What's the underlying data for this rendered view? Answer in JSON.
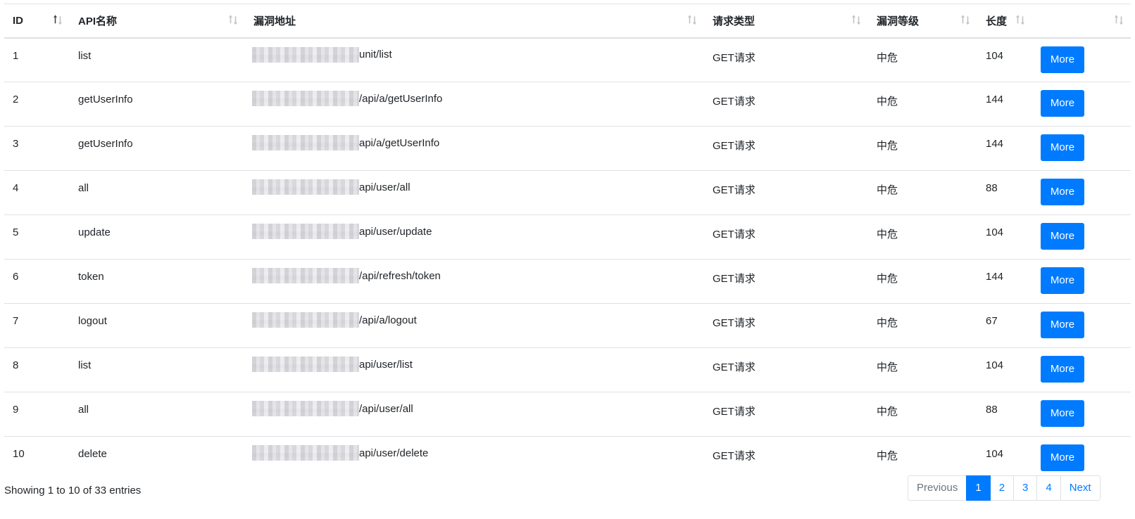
{
  "table": {
    "columns": [
      {
        "label": "ID",
        "sort": "asc"
      },
      {
        "label": "API名称",
        "sort": "none"
      },
      {
        "label": "漏洞地址",
        "sort": "none"
      },
      {
        "label": "请求类型",
        "sort": "none"
      },
      {
        "label": "漏洞等级",
        "sort": "none"
      },
      {
        "label": "长度",
        "sort": "none"
      },
      {
        "label": "",
        "sort": "none"
      }
    ],
    "rows": [
      {
        "id": "1",
        "name": "list",
        "address": "unit/list",
        "method": "GET请求",
        "level": "中危",
        "length": "104",
        "action": "More"
      },
      {
        "id": "2",
        "name": "getUserInfo",
        "address": "/api/a/getUserInfo",
        "method": "GET请求",
        "level": "中危",
        "length": "144",
        "action": "More"
      },
      {
        "id": "3",
        "name": "getUserInfo",
        "address": "api/a/getUserInfo",
        "method": "GET请求",
        "level": "中危",
        "length": "144",
        "action": "More"
      },
      {
        "id": "4",
        "name": "all",
        "address": "api/user/all",
        "method": "GET请求",
        "level": "中危",
        "length": "88",
        "action": "More"
      },
      {
        "id": "5",
        "name": "update",
        "address": "api/user/update",
        "method": "GET请求",
        "level": "中危",
        "length": "104",
        "action": "More"
      },
      {
        "id": "6",
        "name": "token",
        "address": "/api/refresh/token",
        "method": "GET请求",
        "level": "中危",
        "length": "144",
        "action": "More"
      },
      {
        "id": "7",
        "name": "logout",
        "address": "/api/a/logout",
        "method": "GET请求",
        "level": "中危",
        "length": "67",
        "action": "More"
      },
      {
        "id": "8",
        "name": "list",
        "address": "api/user/list",
        "method": "GET请求",
        "level": "中危",
        "length": "104",
        "action": "More"
      },
      {
        "id": "9",
        "name": "all",
        "address": "/api/user/all",
        "method": "GET请求",
        "level": "中危",
        "length": "88",
        "action": "More"
      },
      {
        "id": "10",
        "name": "delete",
        "address": "api/user/delete",
        "method": "GET请求",
        "level": "中危",
        "length": "104",
        "action": "More"
      }
    ]
  },
  "footer": {
    "info": "Showing 1 to 10 of 33 entries"
  },
  "pagination": {
    "previous": "Previous",
    "pages": [
      "1",
      "2",
      "3",
      "4"
    ],
    "current": "1",
    "next": "Next"
  },
  "colors": {
    "primary": "#007bff",
    "border": "#dee2e6",
    "disabled_text": "#6c757d"
  }
}
